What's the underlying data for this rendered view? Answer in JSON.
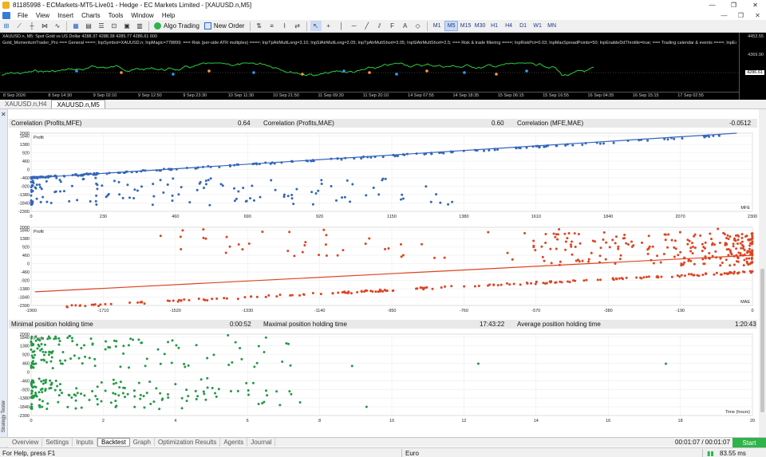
{
  "window": {
    "title": "81185998 - ECMarkets-MT5-Live01 - Hedge - EC Markets Limited - [XAUUSD.n,M5]"
  },
  "menu": [
    "File",
    "View",
    "Insert",
    "Charts",
    "Tools",
    "Window",
    "Help"
  ],
  "toolbar": {
    "algo_trading": "Algo Trading",
    "new_order": "New Order",
    "timeframes": [
      "M1",
      "M5",
      "M15",
      "M30",
      "H1",
      "H4",
      "D1",
      "W1",
      "MN"
    ],
    "active_timeframe": "M5"
  },
  "chart": {
    "header": "XAUUSD.n, M5:  Spot Gold vs US Dollar  4288.37 4288.38 4285.77 4286.61  600",
    "params": "Gold_MomentumTrader_Pro  === General ====; InpSymbol=XAUUSD.n; InpMagic=778899; === Risk (per-side ATR multiples) ====; InpTpAtrMultLong=3.10; InpSlAtrMultLong=2.05; InpTpAtrMultShort=3.05; InpSlAtrMultShort=2.5; === Risk & trade filtering ====; InpRiskPct=0.03; InpMaxSpreadPoints=50; InpEnableDdThrottle=true; === Trading calendar & events ====; InpExtraHolidayDa",
    "price_top": "4453.55",
    "price_mid": "4369.90",
    "price_current": "4286.61",
    "time_labels": [
      "8 Sep 2026",
      "8 Sep 14:30",
      "9 Sep 02:10",
      "9 Sep 12:50",
      "9 Sep 23:30",
      "10 Sep 11:30",
      "10 Sep 21:50",
      "11 Sep 09:30",
      "11 Sep 20:10",
      "14 Sep 07:55",
      "14 Sep 18:35",
      "15 Sep 06:15",
      "15 Sep 16:55",
      "16 Sep 04:35",
      "16 Sep 15:15",
      "17 Sep 02:55"
    ]
  },
  "chart_tabs": [
    "XAUUSD.n,H4",
    "XAUUSD.n,M5"
  ],
  "active_chart_tab": "XAUUSD.n,M5",
  "tester": {
    "side_label": "Strategy Tester",
    "correlation": {
      "profits_mfe_label": "Correlation (Profits,MFE)",
      "profits_mfe_value": "0.64",
      "profits_mae_label": "Correlation (Profits,MAE)",
      "profits_mae_value": "0.60",
      "mfe_mae_label": "Correlation (MFE,MAE)",
      "mfe_mae_value": "-0.0512"
    },
    "holding": {
      "min_label": "Minimal position holding time",
      "min_value": "0:00:52",
      "max_label": "Maximal position holding time",
      "max_value": "17:43:22",
      "avg_label": "Average position holding time",
      "avg_value": "1:20:43"
    }
  },
  "chart_data": [
    {
      "type": "scatter",
      "ylabel": "Profit",
      "xlabel": "MFE",
      "color": "#3366bb",
      "y_ticks": [
        2000,
        1840,
        1380,
        920,
        460,
        0,
        -460,
        -920,
        -1380,
        -1840,
        -2300
      ],
      "x_ticks": [
        0,
        230,
        460,
        690,
        920,
        1150,
        1380,
        1610,
        1840,
        2070,
        2300
      ],
      "xlim": [
        0,
        2300
      ],
      "ylim": [
        -2300,
        2000
      ],
      "trendline": [
        [
          0,
          -460
        ],
        [
          2250,
          2000
        ]
      ]
    },
    {
      "type": "scatter",
      "ylabel": "Profit",
      "xlabel": "MAE",
      "color": "#dd4422",
      "y_ticks": [
        2000,
        1840,
        1380,
        920,
        460,
        0,
        -460,
        -920,
        -1380,
        -1840,
        -2300
      ],
      "x_ticks": [
        -1900,
        -1710,
        -1520,
        -1330,
        -1140,
        -950,
        -760,
        -570,
        -380,
        -190,
        0
      ],
      "xlim": [
        -1900,
        0
      ],
      "ylim": [
        -2300,
        2000
      ],
      "trendline": [
        [
          -1890,
          -1550
        ],
        [
          0,
          460
        ]
      ]
    },
    {
      "type": "scatter",
      "ylabel": "Profit",
      "xlabel": "Time (hours)",
      "color": "#229944",
      "y_ticks": [
        2000,
        1840,
        1380,
        920,
        460,
        0,
        -460,
        -920,
        -1380,
        -1840,
        -2300
      ],
      "x_ticks": [
        0,
        2,
        4,
        6,
        8,
        10,
        12,
        14,
        16,
        18,
        20
      ],
      "xlim": [
        0,
        20
      ],
      "ylim": [
        -2300,
        2000
      ]
    }
  ],
  "bottom_tabs": [
    "Overview",
    "Settings",
    "Inputs",
    "Backtest",
    "Graph",
    "Optimization Results",
    "Agents",
    "Journal"
  ],
  "active_bottom_tab": "Backtest",
  "timer": "00:01:07 / 00:01:07",
  "start_button": "Start",
  "status": {
    "help": "For Help, press F1",
    "currency": "Euro",
    "ping": "83.55 ms"
  }
}
